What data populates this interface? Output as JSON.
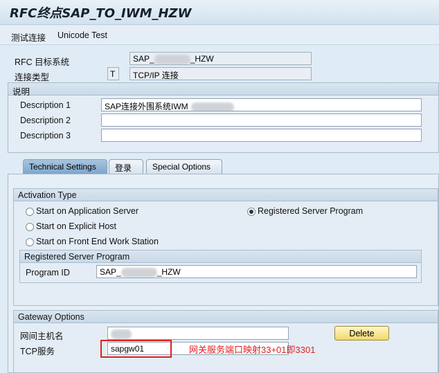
{
  "window": {
    "title": "RFC终点SAP_TO_IWM_HZW"
  },
  "menu": {
    "items": [
      "测试连接",
      "Unicode Test"
    ]
  },
  "header": {
    "rfc_target_label": "RFC 目标系统",
    "rfc_target_prefix": "SAP_",
    "rfc_target_suffix": "_HZW",
    "conn_type_label": "连接类型",
    "conn_type_code": "T",
    "conn_type_value": "TCP/IP 连接"
  },
  "description": {
    "title": "说明",
    "d1_label": "Description 1",
    "d1_value": "SAP连接外围系统IWM",
    "d2_label": "Description 2",
    "d2_value": "",
    "d3_label": "Description 3",
    "d3_value": ""
  },
  "tabs": [
    {
      "label": "Technical Settings",
      "active": true
    },
    {
      "label": "登录",
      "active": false
    },
    {
      "label": "Special Options",
      "active": false
    }
  ],
  "activation": {
    "title": "Activation Type",
    "options": [
      {
        "label": "Start on Application Server",
        "selected": false
      },
      {
        "label": "Start on Explicit Host",
        "selected": false
      },
      {
        "label": "Start on Front End Work Station",
        "selected": false
      },
      {
        "label": "Registered Server Program",
        "selected": true
      }
    ]
  },
  "registered": {
    "title": "Registered Server Program",
    "program_id_label": "Program ID",
    "program_id_prefix": "SAP_",
    "program_id_suffix": "_HZW"
  },
  "gateway": {
    "title": "Gateway Options",
    "host_label": "网间主机名",
    "service_label": "TCP服务",
    "service_value": "sapgw01",
    "delete_label": "Delete",
    "annotation": "网关服务端口映射33+01即3301"
  },
  "colors": {
    "annotation_red": "#e02020",
    "active_tab": "#8fb0d2",
    "button_yellow": "#f2d86b"
  }
}
